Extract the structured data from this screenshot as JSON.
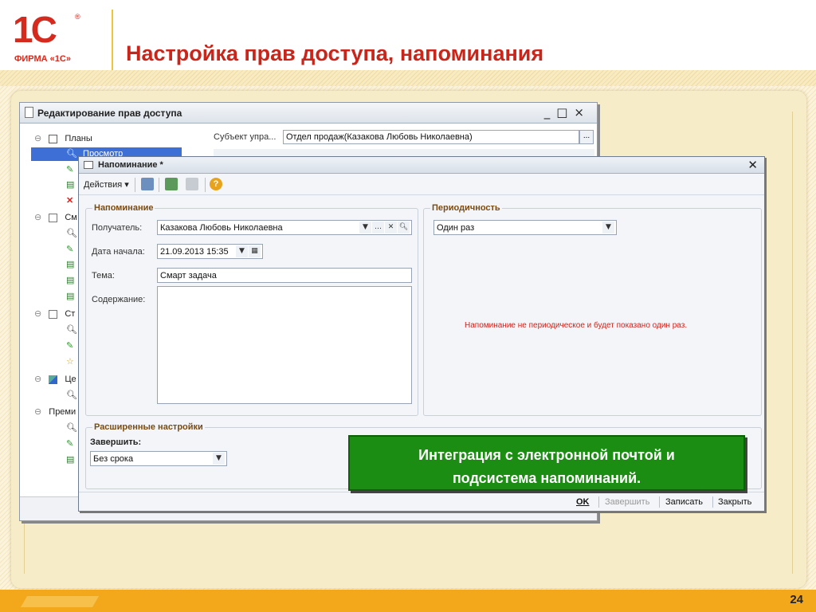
{
  "slide": {
    "logo_text": "ФИРМА «1С»",
    "title": "Настройка прав доступа, напоминания",
    "page_number": "24"
  },
  "window_access": {
    "title": "Редактирование прав доступа",
    "subject_label": "Субъект упра...",
    "subject_value": "Отдел продаж(Казакова Любовь Николаевна)",
    "subject_button": "...",
    "tree": [
      {
        "label": "Планы"
      },
      {
        "label": "Просмотр"
      },
      {
        "label": "См"
      },
      {
        "label": "Ст"
      },
      {
        "label": "Це"
      },
      {
        "label": "Преми"
      }
    ]
  },
  "window_reminder": {
    "title": "Напоминание *",
    "actions_label": "Действия",
    "group_reminder": "Напоминание",
    "recipient_label": "Получатель:",
    "recipient_value": "Казакова Любовь Николаевна",
    "start_date_label": "Дата начала:",
    "start_date_value": "21.09.2013 15:35",
    "topic_label": "Тема:",
    "topic_value": "Смарт задача",
    "content_label": "Содержание:",
    "group_periodicity": "Периодичность",
    "periodicity_value": "Один раз",
    "periodicity_message": "Напоминание не периодическое и будет показано один раз.",
    "group_advanced": "Расширенные настройки",
    "finish_label": "Завершить:",
    "finish_value": "Без срока",
    "buttons": {
      "ok": "OK",
      "finish": "Завершить",
      "save": "Записать",
      "close": "Закрыть"
    }
  },
  "callout": {
    "line1": "Интеграция с электронной почтой и",
    "line2": "подсистема напоминаний."
  }
}
